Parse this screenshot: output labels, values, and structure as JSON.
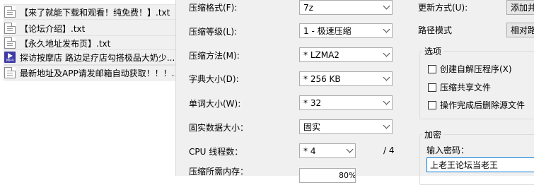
{
  "files": [
    {
      "name": "【来了就能下载和观看！纯免费！】.txt",
      "icon": "txt"
    },
    {
      "name": "【论坛介绍】.txt",
      "icon": "txt"
    },
    {
      "name": "【永久地址发布页】.txt",
      "icon": "txt"
    },
    {
      "name": "探访按摩店 路边足疗店勾搭极品大奶少...",
      "icon": "mp4",
      "badge": "MP4"
    },
    {
      "name": "最新地址及APP请发邮箱自动获取！！！...",
      "icon": "txt"
    }
  ],
  "settings": {
    "format_label": "压缩格式(F):",
    "format_value": "7z",
    "level_label": "压缩等级(L):",
    "level_value": "1 - 极速压缩",
    "method_label": "压缩方法(M):",
    "method_value": "* LZMA2",
    "dict_label": "字典大小(D):",
    "dict_value": "* 256 KB",
    "word_label": "单词大小(W):",
    "word_value": "* 32",
    "solid_label": "固实数据大小：",
    "solid_value": "固实",
    "cpu_label": "CPU 线程数：",
    "cpu_value": "* 4",
    "cpu_total": "/ 4",
    "memory_label": "压缩所需内存：",
    "memory_value": "80%"
  },
  "right": {
    "update_label": "更新方式(U):",
    "update_value": "添加并",
    "path_label": "路径模式",
    "path_value": "相对路",
    "options_title": "选项",
    "options": [
      {
        "label": "创建自解压程序(X)",
        "checked": false
      },
      {
        "label": "压缩共享文件",
        "checked": false
      },
      {
        "label": "操作完成后删除源文件",
        "checked": false
      }
    ],
    "encrypt_title": "加密",
    "password_label": "输入密码：",
    "password_value": "上老王论坛当老王"
  }
}
